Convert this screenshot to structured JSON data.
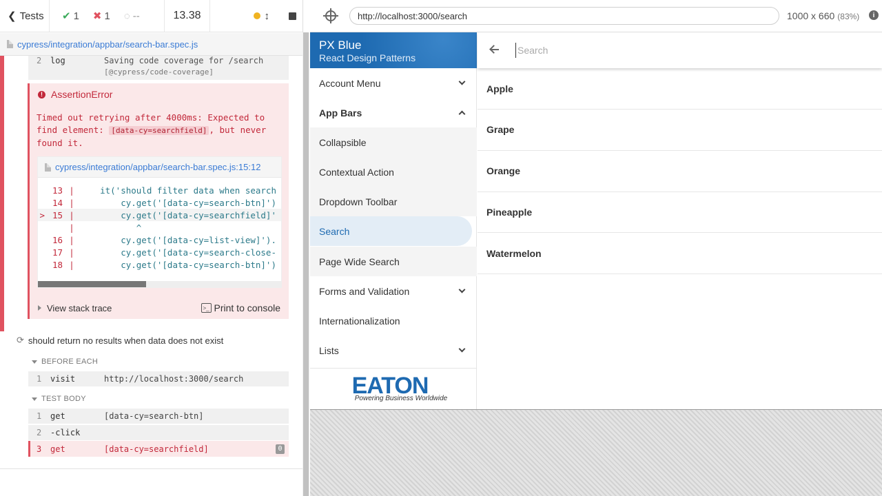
{
  "reporter": {
    "tests_label": "Tests",
    "passed": "1",
    "failed": "1",
    "pending": "--",
    "duration": "13.38",
    "spec_path": "cypress/integration/appbar/search-bar.spec.js",
    "log_row": {
      "num": "2",
      "name": "log",
      "line1": "Saving code coverage for /search",
      "line2": "[@cypress/code-coverage]"
    },
    "error": {
      "title": "AssertionError",
      "msg_part1": "Timed out retrying after 4000ms: Expected to find element: ",
      "msg_code": "[data-cy=searchfield]",
      "msg_part2": ", but never found it.",
      "frame_path": "cypress/integration/appbar/search-bar.spec.js:15:12",
      "code_lines": [
        {
          "mark": "",
          "num": "13",
          "bar": "|",
          "code": "    it('should filter data when search"
        },
        {
          "mark": "",
          "num": "14",
          "bar": "|",
          "code": "        cy.get('[data-cy=search-btn]')"
        },
        {
          "mark": ">",
          "num": "15",
          "bar": "|",
          "code": "        cy.get('[data-cy=searchfield]'"
        },
        {
          "mark": "",
          "num": "",
          "bar": "|",
          "code": "           ^"
        },
        {
          "mark": "",
          "num": "16",
          "bar": "|",
          "code": "        cy.get('[data-cy=list-view]')."
        },
        {
          "mark": "",
          "num": "17",
          "bar": "|",
          "code": "        cy.get('[data-cy=search-close-"
        },
        {
          "mark": "",
          "num": "18",
          "bar": "|",
          "code": "        cy.get('[data-cy=search-btn]')"
        }
      ],
      "view_stack": "View stack trace",
      "print_console": "Print to console"
    },
    "test2_title": "should return no results when data does not exist",
    "before_each_label": "BEFORE EACH",
    "before_each_cmds": [
      {
        "num": "1",
        "name": "visit",
        "msg": "http://localhost:3000/search"
      }
    ],
    "test_body_label": "TEST BODY",
    "body_cmds": [
      {
        "num": "1",
        "name": "get",
        "msg": "[data-cy=search-btn]"
      },
      {
        "num": "2",
        "name": "-click",
        "msg": ""
      }
    ],
    "fail_cmd": {
      "num": "3",
      "name": "get",
      "msg": "[data-cy=searchfield]",
      "count": "0"
    }
  },
  "aut": {
    "url": "http://localhost:3000/search",
    "viewport": "1000 x 660",
    "zoom": "(83%)"
  },
  "app": {
    "drawer_title": "PX Blue",
    "drawer_subtitle": "React Design Patterns",
    "nav": [
      {
        "label": "Account Menu",
        "chevron": "down"
      },
      {
        "label": "App Bars",
        "chevron": "up"
      },
      {
        "label": "Collapsible",
        "chevron": ""
      },
      {
        "label": "Contextual Action",
        "chevron": ""
      },
      {
        "label": "Dropdown Toolbar",
        "chevron": ""
      },
      {
        "label": "Search",
        "chevron": ""
      },
      {
        "label": "Page Wide Search",
        "chevron": ""
      },
      {
        "label": "Forms and Validation",
        "chevron": "down"
      },
      {
        "label": "Internationalization",
        "chevron": ""
      },
      {
        "label": "Lists",
        "chevron": "down"
      }
    ],
    "logo_text": "EATON",
    "logo_tagline": "Powering Business Worldwide",
    "search_placeholder": "Search",
    "results": [
      "Apple",
      "Grape",
      "Orange",
      "Pineapple",
      "Watermelon"
    ],
    "colors": {
      "brand_blue": "#1e6ab1",
      "error_red": "#c2283a",
      "fail_bar": "#e05260"
    }
  }
}
